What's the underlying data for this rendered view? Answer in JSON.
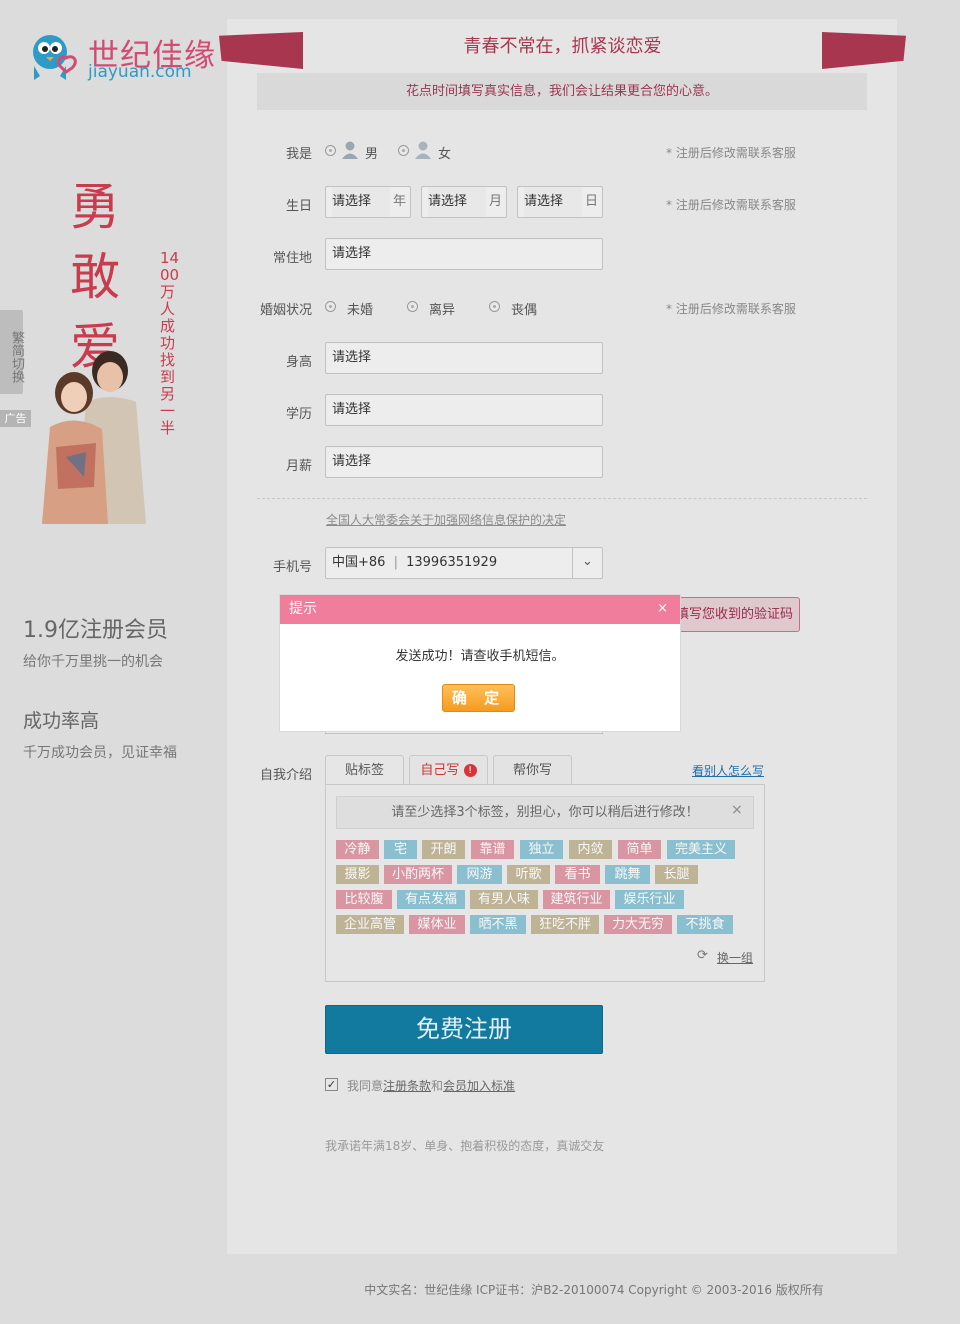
{
  "logo": {
    "cn": "世纪佳缘",
    "en": "jiayuan.com"
  },
  "side_tab": "繁简切换",
  "ad": {
    "label": "广告",
    "slogan": "勇敢爱",
    "vertical_text": "1400万人成功找到另一半"
  },
  "stats": [
    {
      "title": "1.9亿注册会员",
      "subtitle": "给你千万里挑一的机会"
    },
    {
      "title": "成功率高",
      "subtitle": "千万成功会员，见证幸福"
    }
  ],
  "slogan": "青春不常在，抓紧谈恋爱",
  "hint": "花点时间填写真实信息，我们会让结果更合您的心意。",
  "form": {
    "gender": {
      "label": "我是",
      "male": "男",
      "female": "女",
      "note": "* 注册后修改需联系客服"
    },
    "birth": {
      "label": "生日",
      "placeholder": "请选择",
      "year": "年",
      "month": "月",
      "day": "日",
      "note": "* 注册后修改需联系客服"
    },
    "residence": {
      "label": "常住地",
      "value": "请选择"
    },
    "marital": {
      "label": "婚姻状况",
      "options": [
        "未婚",
        "离异",
        "丧偶"
      ],
      "note": "* 注册后修改需联系客服"
    },
    "height": {
      "label": "身高",
      "value": "请选择"
    },
    "education": {
      "label": "学历",
      "value": "请选择"
    },
    "salary": {
      "label": "月薪",
      "value": "请选择"
    },
    "law_link": "全国人大常委会关于加强网络信息保护的决定",
    "phone": {
      "label": "手机号",
      "prefix": "中国+86",
      "separator": "|",
      "value": "13996351929"
    },
    "code": {
      "label_partial": "验",
      "button": "填写您收到的验证码"
    },
    "nickname": {
      "label_partial": "创"
    },
    "intro": {
      "label": "自我介绍",
      "tabs": [
        "贴标签",
        "自己写",
        "帮你写"
      ],
      "see_others": "看别人怎么写",
      "tip": "请至少选择3个标签，别担心，你可以稍后进行修改！",
      "tags": [
        "冷静",
        "宅",
        "开朗",
        "靠谱",
        "独立",
        "内敛",
        "简单",
        "完美主义",
        "摄影",
        "小酌两杯",
        "网游",
        "听歌",
        "看书",
        "跳舞",
        "长腿",
        "比较腹",
        "有点发福",
        "有男人味",
        "建筑行业",
        "娱乐行业",
        "企业高管",
        "媒体业",
        "晒不黑",
        "狂吃不胖",
        "力大无穷",
        "不挑食"
      ],
      "refresh": "换一组"
    },
    "register_button": "免费注册",
    "agree": {
      "prefix": "我同意",
      "terms": "注册条款",
      "and": "和",
      "standard": "会员加入标准"
    },
    "promise": "我承诺年满18岁、单身、抱着积极的态度，真诚交友"
  },
  "footer": "中文实名：世纪佳缘 ICP证书：沪B2-20100074 Copyright © 2003-2016 版权所有",
  "dialog": {
    "title": "提示",
    "close": "×",
    "message": "发送成功！请查收手机短信。",
    "ok": "确 定"
  },
  "colors": {
    "brand_pink": "#d24b72",
    "brand_blue": "#2e9bc7",
    "ribbon": "#a8364f",
    "dialog_header": "#f17d9c",
    "register": "#127a9e"
  }
}
